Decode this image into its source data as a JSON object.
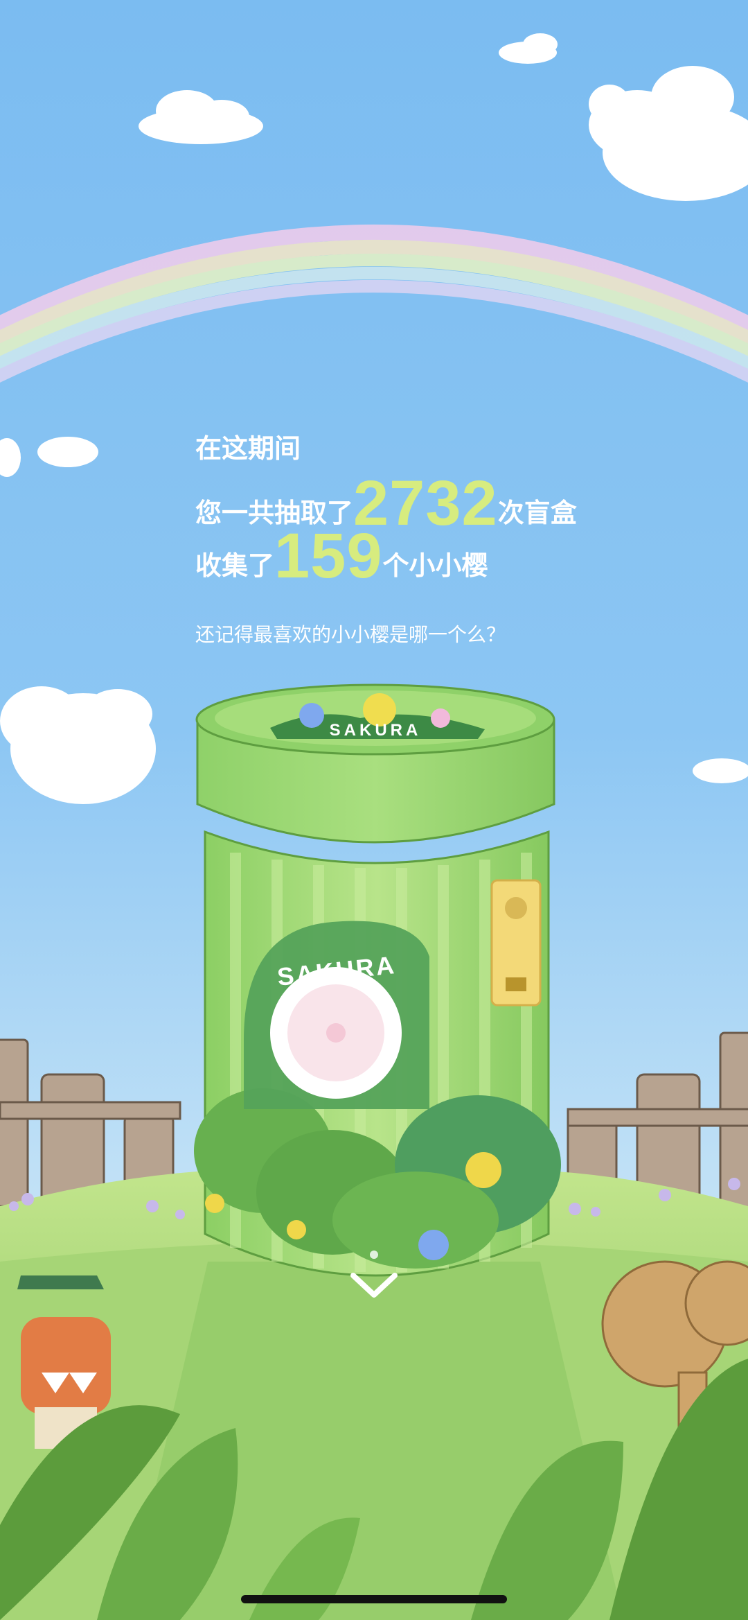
{
  "summary": {
    "heading": "在这期间",
    "draws_prefix": "您一共抽取了",
    "draws_count": "2732",
    "draws_suffix": "次盲盒",
    "collect_prefix": "收集了",
    "collect_count": "159",
    "collect_suffix": "个小小樱",
    "question": "还记得最喜欢的小小樱是哪一个么？"
  },
  "jar": {
    "lid_label": "SAKURA",
    "body_label": "SAKURA"
  },
  "colors": {
    "sky_top": "#7fbef0",
    "sky_bottom": "#cfe7f7",
    "highlight_number": "#d7ec7f",
    "jar_green": "#a9db7c",
    "grass": "#9fd070"
  },
  "icons": {
    "scroll_down": "chevron-down-icon"
  }
}
